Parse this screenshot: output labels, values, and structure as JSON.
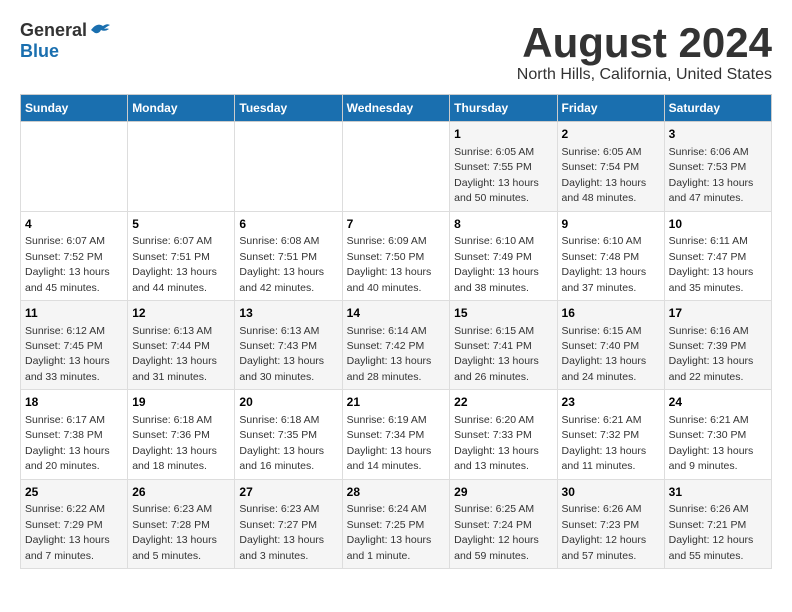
{
  "header": {
    "logo_general": "General",
    "logo_blue": "Blue",
    "month": "August 2024",
    "location": "North Hills, California, United States"
  },
  "weekdays": [
    "Sunday",
    "Monday",
    "Tuesday",
    "Wednesday",
    "Thursday",
    "Friday",
    "Saturday"
  ],
  "weeks": [
    [
      {
        "day": "",
        "info": ""
      },
      {
        "day": "",
        "info": ""
      },
      {
        "day": "",
        "info": ""
      },
      {
        "day": "",
        "info": ""
      },
      {
        "day": "1",
        "info": "Sunrise: 6:05 AM\nSunset: 7:55 PM\nDaylight: 13 hours\nand 50 minutes."
      },
      {
        "day": "2",
        "info": "Sunrise: 6:05 AM\nSunset: 7:54 PM\nDaylight: 13 hours\nand 48 minutes."
      },
      {
        "day": "3",
        "info": "Sunrise: 6:06 AM\nSunset: 7:53 PM\nDaylight: 13 hours\nand 47 minutes."
      }
    ],
    [
      {
        "day": "4",
        "info": "Sunrise: 6:07 AM\nSunset: 7:52 PM\nDaylight: 13 hours\nand 45 minutes."
      },
      {
        "day": "5",
        "info": "Sunrise: 6:07 AM\nSunset: 7:51 PM\nDaylight: 13 hours\nand 44 minutes."
      },
      {
        "day": "6",
        "info": "Sunrise: 6:08 AM\nSunset: 7:51 PM\nDaylight: 13 hours\nand 42 minutes."
      },
      {
        "day": "7",
        "info": "Sunrise: 6:09 AM\nSunset: 7:50 PM\nDaylight: 13 hours\nand 40 minutes."
      },
      {
        "day": "8",
        "info": "Sunrise: 6:10 AM\nSunset: 7:49 PM\nDaylight: 13 hours\nand 38 minutes."
      },
      {
        "day": "9",
        "info": "Sunrise: 6:10 AM\nSunset: 7:48 PM\nDaylight: 13 hours\nand 37 minutes."
      },
      {
        "day": "10",
        "info": "Sunrise: 6:11 AM\nSunset: 7:47 PM\nDaylight: 13 hours\nand 35 minutes."
      }
    ],
    [
      {
        "day": "11",
        "info": "Sunrise: 6:12 AM\nSunset: 7:45 PM\nDaylight: 13 hours\nand 33 minutes."
      },
      {
        "day": "12",
        "info": "Sunrise: 6:13 AM\nSunset: 7:44 PM\nDaylight: 13 hours\nand 31 minutes."
      },
      {
        "day": "13",
        "info": "Sunrise: 6:13 AM\nSunset: 7:43 PM\nDaylight: 13 hours\nand 30 minutes."
      },
      {
        "day": "14",
        "info": "Sunrise: 6:14 AM\nSunset: 7:42 PM\nDaylight: 13 hours\nand 28 minutes."
      },
      {
        "day": "15",
        "info": "Sunrise: 6:15 AM\nSunset: 7:41 PM\nDaylight: 13 hours\nand 26 minutes."
      },
      {
        "day": "16",
        "info": "Sunrise: 6:15 AM\nSunset: 7:40 PM\nDaylight: 13 hours\nand 24 minutes."
      },
      {
        "day": "17",
        "info": "Sunrise: 6:16 AM\nSunset: 7:39 PM\nDaylight: 13 hours\nand 22 minutes."
      }
    ],
    [
      {
        "day": "18",
        "info": "Sunrise: 6:17 AM\nSunset: 7:38 PM\nDaylight: 13 hours\nand 20 minutes."
      },
      {
        "day": "19",
        "info": "Sunrise: 6:18 AM\nSunset: 7:36 PM\nDaylight: 13 hours\nand 18 minutes."
      },
      {
        "day": "20",
        "info": "Sunrise: 6:18 AM\nSunset: 7:35 PM\nDaylight: 13 hours\nand 16 minutes."
      },
      {
        "day": "21",
        "info": "Sunrise: 6:19 AM\nSunset: 7:34 PM\nDaylight: 13 hours\nand 14 minutes."
      },
      {
        "day": "22",
        "info": "Sunrise: 6:20 AM\nSunset: 7:33 PM\nDaylight: 13 hours\nand 13 minutes."
      },
      {
        "day": "23",
        "info": "Sunrise: 6:21 AM\nSunset: 7:32 PM\nDaylight: 13 hours\nand 11 minutes."
      },
      {
        "day": "24",
        "info": "Sunrise: 6:21 AM\nSunset: 7:30 PM\nDaylight: 13 hours\nand 9 minutes."
      }
    ],
    [
      {
        "day": "25",
        "info": "Sunrise: 6:22 AM\nSunset: 7:29 PM\nDaylight: 13 hours\nand 7 minutes."
      },
      {
        "day": "26",
        "info": "Sunrise: 6:23 AM\nSunset: 7:28 PM\nDaylight: 13 hours\nand 5 minutes."
      },
      {
        "day": "27",
        "info": "Sunrise: 6:23 AM\nSunset: 7:27 PM\nDaylight: 13 hours\nand 3 minutes."
      },
      {
        "day": "28",
        "info": "Sunrise: 6:24 AM\nSunset: 7:25 PM\nDaylight: 13 hours\nand 1 minute."
      },
      {
        "day": "29",
        "info": "Sunrise: 6:25 AM\nSunset: 7:24 PM\nDaylight: 12 hours\nand 59 minutes."
      },
      {
        "day": "30",
        "info": "Sunrise: 6:26 AM\nSunset: 7:23 PM\nDaylight: 12 hours\nand 57 minutes."
      },
      {
        "day": "31",
        "info": "Sunrise: 6:26 AM\nSunset: 7:21 PM\nDaylight: 12 hours\nand 55 minutes."
      }
    ]
  ]
}
